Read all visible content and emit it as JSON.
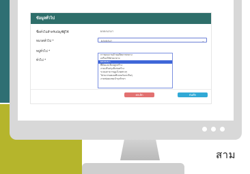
{
  "dialog": {
    "title": "ข้อมูลทั่วไป",
    "rows": [
      {
        "label": "ชื่อทั่วไปสำหรับบัญชีผู้ใช้",
        "value": "ผลลงนามา"
      },
      {
        "label": "หมวดทั่วไป *",
        "value": "ผลงลงนา"
      },
      {
        "label": "หมู่ทั่วไป *",
        "value": ""
      },
      {
        "label": "ทั่วไป *",
        "value": ""
      }
    ],
    "dropdown_items": [
      "การผลงงานด้านผลิตภาพกลาง",
      "เครื่องใช้ส่วนกลาง",
      "ผลงลงนา",
      "ที่ดินและสิ่งปลูกสร้าง",
      "งานปรับปรุงสิ่งก่อสร้าง",
      "ระบบสาธารณูปโภคต่างๆ",
      "โปรแกรมคอมพิวเตอร์และอื่นๆ",
      "งานซ่อมแซมบำรุงรักษา"
    ],
    "selected_index": 2,
    "cancel_label": "ยกเลิก",
    "save_label": "บันทึก"
  },
  "caption": "สาม",
  "colors": {
    "header": "#2e6e6a",
    "cancel": "#e27171",
    "save": "#31a9d6",
    "selection": "#3f67d8",
    "teal_bg": "#2f6f73",
    "olive_bg": "#b5b52c"
  }
}
